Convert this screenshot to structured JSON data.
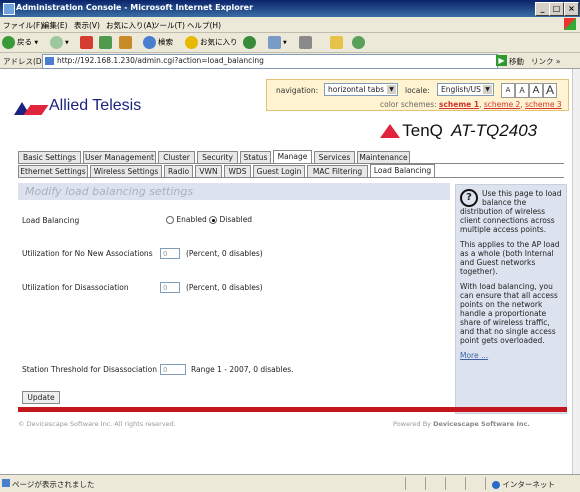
{
  "window": {
    "title": "Administration Console - Microsoft Internet Explorer",
    "buttons": [
      "_",
      "□",
      "×"
    ]
  },
  "menu": [
    "ファイル(F)",
    "編集(E)",
    "表示(V)",
    "お気に入り(A)",
    "ツール(T)",
    "ヘルプ(H)"
  ],
  "toolbar": {
    "back": "戻る",
    "search": "検索",
    "favorites": "お気に入り"
  },
  "address": {
    "label": "アドレス(D)",
    "url": "http://192.168.1.230/admin.cgi?action=load_balancing",
    "go": "移動",
    "links": "リンク »"
  },
  "brand": {
    "logo_text": "Allied Telesis",
    "partner": "TenQ",
    "model": "AT-TQ2403"
  },
  "options": {
    "navigation_label": "navigation:",
    "navigation_value": "horizontal tabs",
    "locale_label": "locale:",
    "locale_value": "English/US",
    "font_buttons": [
      "A",
      "A",
      "A",
      "A"
    ],
    "color_schemes_label": "color schemes:",
    "schemes": [
      "scheme 1",
      "scheme 2",
      "scheme 3"
    ]
  },
  "tabs_main": [
    "Basic Settings",
    "User Management",
    "Cluster",
    "Security",
    "Status",
    "Manage",
    "Services",
    "Maintenance"
  ],
  "tabs_main_active": "Manage",
  "tabs_sub": [
    "Ethernet Settings",
    "Wireless Settings",
    "Radio",
    "VWN",
    "WDS",
    "Guest Login",
    "MAC Filtering",
    "Load Balancing"
  ],
  "tabs_sub_active": "Load Balancing",
  "content": {
    "heading": "Modify load balancing settings",
    "load_balancing_label": "Load Balancing",
    "enabled_label": "Enabled",
    "disabled_label": "Disabled",
    "load_balancing_value": "Disabled",
    "util_no_new_label": "Utilization for No New Associations",
    "util_no_new_value": "0",
    "util_no_new_hint": "(Percent, 0 disables)",
    "util_disassoc_label": "Utilization for Disassociation",
    "util_disassoc_value": "0",
    "util_disassoc_hint": "(Percent, 0 disables)",
    "station_threshold_label": "Station Threshold for Disassociation",
    "station_threshold_value": "0",
    "station_threshold_hint": "Range 1 - 2007, 0 disables.",
    "update_button": "Update"
  },
  "help": {
    "p1": "Use this page to load balance the distribution of wireless client connections across multiple access points.",
    "p2": "This applies to the AP load as a whole (both Internal and Guest networks together).",
    "p3": "With load balancing, you can ensure that all access points on the network handle a proportionate share of wireless traffic, and that no single access point gets overloaded.",
    "more": "More ..."
  },
  "footer": {
    "left": "© Devicescape Software Inc. All rights reserved.",
    "right_prefix": "Powered By",
    "right_company": "Devicescape Software Inc."
  },
  "status": {
    "text": "ページが表示されました",
    "zone": "インターネット"
  }
}
